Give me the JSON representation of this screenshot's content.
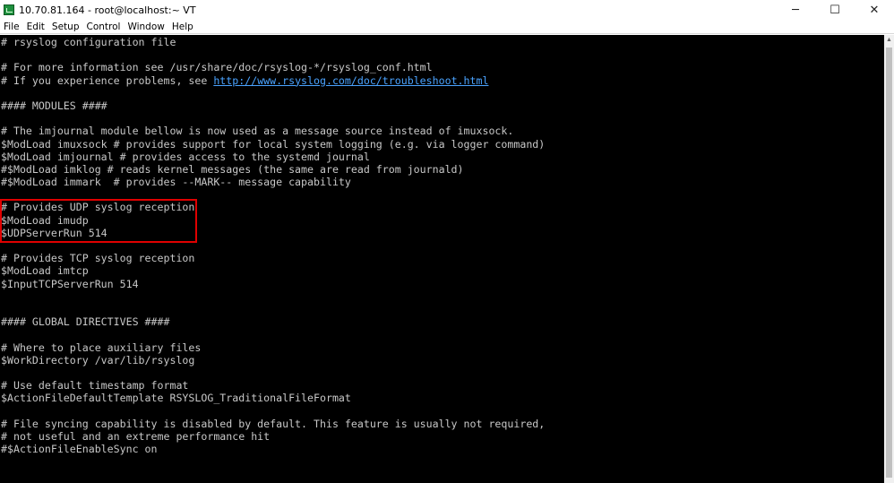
{
  "window": {
    "title": "10.70.81.164 - root@localhost:~ VT",
    "controls": {
      "minimize": "─",
      "maximize": "☐",
      "close": "✕"
    }
  },
  "menu": {
    "items": [
      "File",
      "Edit",
      "Setup",
      "Control",
      "Window",
      "Help"
    ]
  },
  "terminal": {
    "lines": [
      {
        "text": "# rsyslog configuration file"
      },
      {
        "text": ""
      },
      {
        "text": "# For more information see /usr/share/doc/rsyslog-*/rsyslog_conf.html"
      },
      {
        "text": "# If you experience problems, see ",
        "link": "http://www.rsyslog.com/doc/troubleshoot.html"
      },
      {
        "text": ""
      },
      {
        "text": "#### MODULES ####"
      },
      {
        "text": ""
      },
      {
        "text": "# The imjournal module bellow is now used as a message source instead of imuxsock."
      },
      {
        "text": "$ModLoad imuxsock # provides support for local system logging (e.g. via logger command)"
      },
      {
        "text": "$ModLoad imjournal # provides access to the systemd journal"
      },
      {
        "text": "#$ModLoad imklog # reads kernel messages (the same are read from journald)"
      },
      {
        "text": "#$ModLoad immark  # provides --MARK-- message capability"
      },
      {
        "text": ""
      },
      {
        "text": "# Provides UDP syslog reception"
      },
      {
        "text": "$ModLoad imudp"
      },
      {
        "text": "$UDPServerRun 514"
      },
      {
        "text": ""
      },
      {
        "text": "# Provides TCP syslog reception"
      },
      {
        "text": "$ModLoad imtcp"
      },
      {
        "text": "$InputTCPServerRun 514"
      },
      {
        "text": ""
      },
      {
        "text": ""
      },
      {
        "text": "#### GLOBAL DIRECTIVES ####"
      },
      {
        "text": ""
      },
      {
        "text": "# Where to place auxiliary files"
      },
      {
        "text": "$WorkDirectory /var/lib/rsyslog"
      },
      {
        "text": ""
      },
      {
        "text": "# Use default timestamp format"
      },
      {
        "text": "$ActionFileDefaultTemplate RSYSLOG_TraditionalFileFormat"
      },
      {
        "text": ""
      },
      {
        "text": "# File syncing capability is disabled by default. This feature is usually not required,"
      },
      {
        "text": "# not useful and an extreme performance hit"
      },
      {
        "text": "#$ActionFileEnableSync on"
      }
    ]
  },
  "colors": {
    "terminal_bg": "#000000",
    "terminal_fg": "#c8c8c8",
    "link": "#4aa3ff",
    "highlight": "#e00000"
  },
  "icons": {
    "app": "teraterm-icon",
    "scroll_up": "chevron-up-icon"
  }
}
